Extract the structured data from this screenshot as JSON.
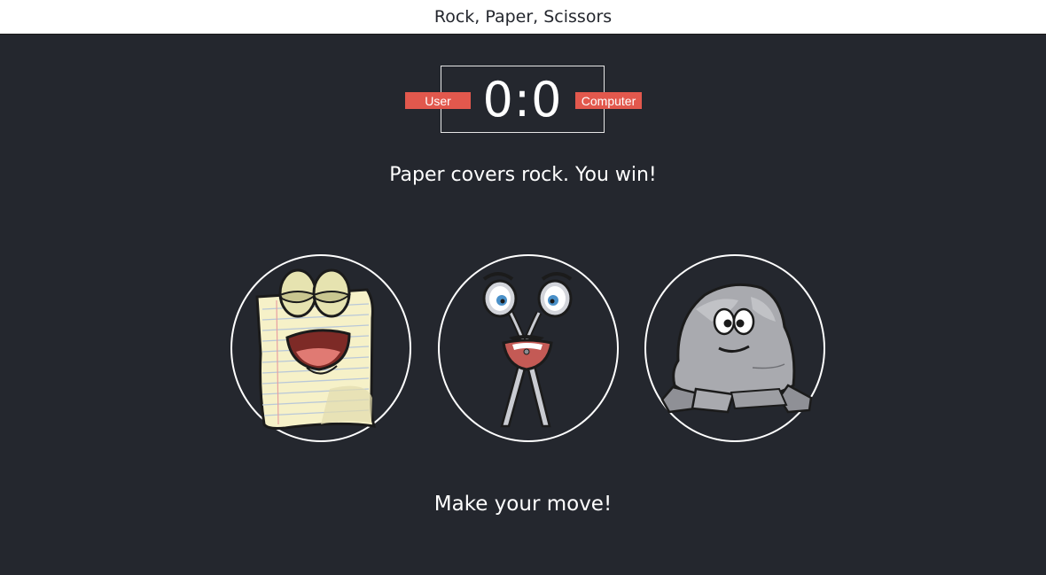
{
  "header": {
    "title": "Rock, Paper, Scissors"
  },
  "scoreboard": {
    "user_label": "User",
    "computer_label": "Computer",
    "score": "0:0"
  },
  "result_message": "Paper covers rock. You win!",
  "choices": [
    {
      "id": "paper",
      "icon": "paper-character-icon"
    },
    {
      "id": "scissors",
      "icon": "scissors-character-icon"
    },
    {
      "id": "rock",
      "icon": "rock-character-icon"
    }
  ],
  "prompt": "Make your move!",
  "colors": {
    "background": "#24272e",
    "header": "#ffffff",
    "badge": "#e2584d",
    "text": "#ffffff"
  }
}
